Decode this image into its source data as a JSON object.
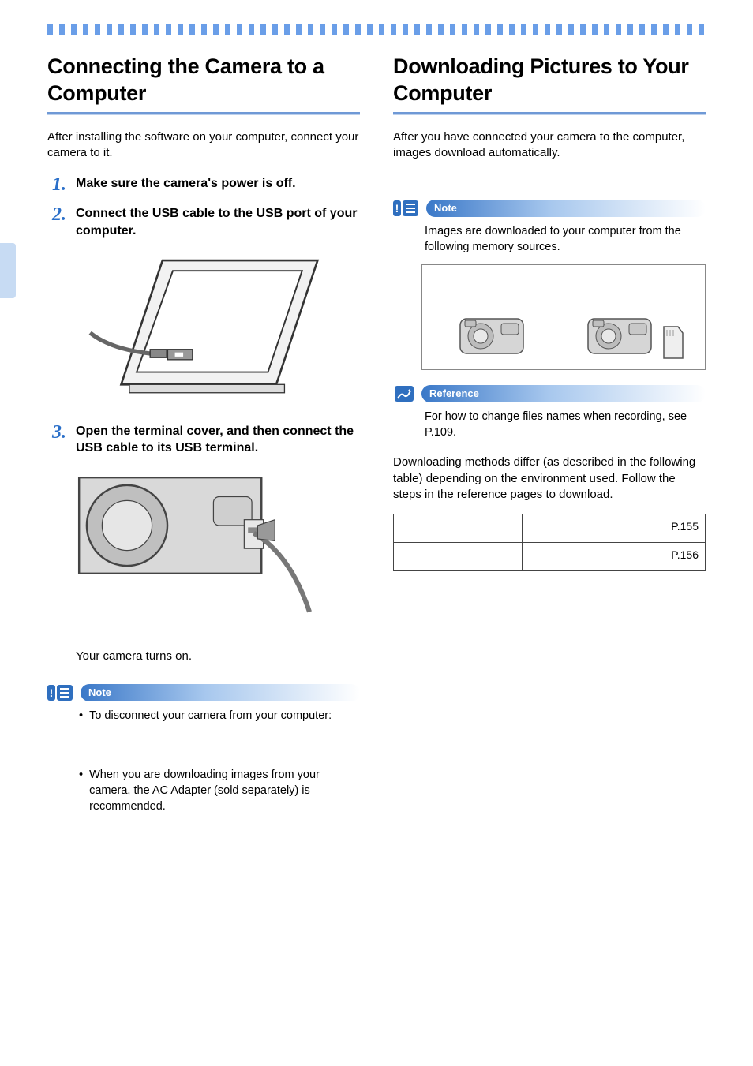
{
  "left": {
    "title": "Connecting the Camera to a Computer",
    "intro": "After installing the software on your computer, connect your camera to it.",
    "steps": [
      {
        "n": "1.",
        "text": "Make sure the camera's power is off."
      },
      {
        "n": "2.",
        "text": "Connect the USB cable to the USB port of your computer."
      },
      {
        "n": "3.",
        "text": "Open the terminal cover, and then connect the USB cable to its USB terminal."
      }
    ],
    "after_step3": "Your camera turns on.",
    "note_label": "Note",
    "note_bullets": [
      "To disconnect your camera from your computer:",
      "When you are downloading images from your camera, the AC Adapter (sold separately) is recommended."
    ]
  },
  "right": {
    "title": "Downloading Pictures to Your Computer",
    "intro": "After you have connected your camera to the computer, images download automatically.",
    "note_label": "Note",
    "note_text": "Images are downloaded to your computer from the following memory sources.",
    "reference_label": "Reference",
    "reference_text": "For how to change files names when recording, see P.109.",
    "para2": "Downloading methods differ (as described in the following table) depending on the environment used. Follow the steps in the reference pages to download.",
    "table": [
      {
        "c1": "",
        "c2": "",
        "c3": "P.155"
      },
      {
        "c1": "",
        "c2": "",
        "c3": "P.156"
      }
    ]
  }
}
